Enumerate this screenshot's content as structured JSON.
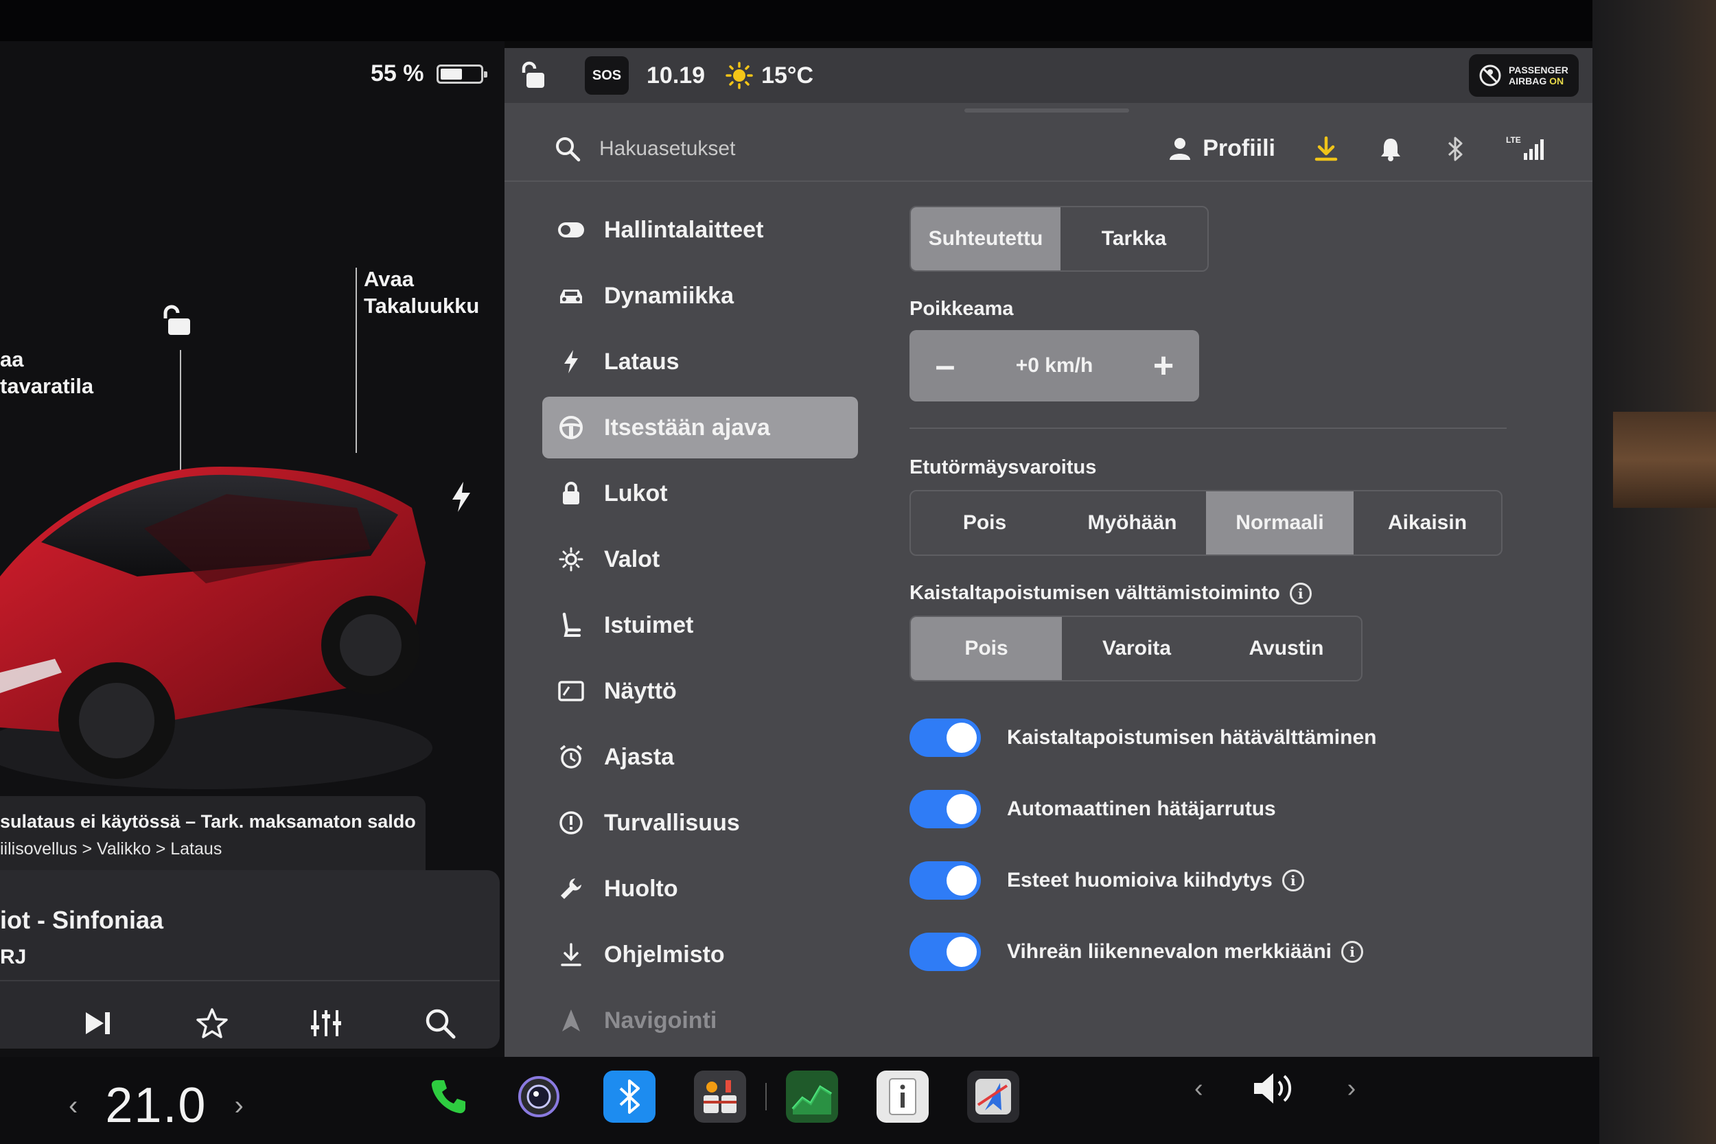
{
  "car_panel": {
    "battery_percent": "55 %",
    "battery_level": 0.55,
    "callout_frunk_line1": "aa",
    "callout_frunk_line2": "tavaratila",
    "callout_trunk_line1": "Avaa",
    "callout_trunk_line2": "Takaluukku",
    "car_color": "#b3121e",
    "notice_line1": "sulataus ei käytössä – Tark. maksamaton saldo",
    "notice_line2": "iilisovellus > Valikko > Lataus"
  },
  "media": {
    "track": "iot - Sinfoniaa",
    "station": "RJ"
  },
  "status_bar": {
    "sos_label": "SOS",
    "time": "10.19",
    "temperature": "15°C",
    "airbag_line1": "PASSENGER",
    "airbag_line2_prefix": "AIRBAG ",
    "airbag_line2_state": "ON"
  },
  "header": {
    "search_placeholder": "Hakuasetukset",
    "profile_label": "Profiili",
    "download_color": "#f0c419",
    "lte_label": "LTE"
  },
  "sidebar": {
    "items": [
      {
        "label": "Hallintalaitteet",
        "icon": "toggle-icon"
      },
      {
        "label": "Dynamiikka",
        "icon": "car-icon"
      },
      {
        "label": "Lataus",
        "icon": "bolt-icon"
      },
      {
        "label": "Itsestään ajava",
        "icon": "steering-wheel-icon",
        "active": true
      },
      {
        "label": "Lukot",
        "icon": "lock-icon"
      },
      {
        "label": "Valot",
        "icon": "light-icon"
      },
      {
        "label": "Istuimet",
        "icon": "seat-icon"
      },
      {
        "label": "Näyttö",
        "icon": "display-icon"
      },
      {
        "label": "Ajasta",
        "icon": "alarm-clock-icon"
      },
      {
        "label": "Turvallisuus",
        "icon": "alert-icon"
      },
      {
        "label": "Huolto",
        "icon": "wrench-icon"
      },
      {
        "label": "Ohjelmisto",
        "icon": "download-icon"
      },
      {
        "label": "Navigointi",
        "icon": "navigation-icon"
      }
    ]
  },
  "content": {
    "speed_mode": {
      "options": [
        "Suhteutettu",
        "Tarkka"
      ],
      "selected": "Suhteutettu"
    },
    "offset_label": "Poikkeama",
    "offset_value": "+0 km/h",
    "fcw_label": "Etutörmäysvaroitus",
    "fcw": {
      "options": [
        "Pois",
        "Myöhään",
        "Normaali",
        "Aikaisin"
      ],
      "selected": "Normaali"
    },
    "lane_label": "Kaistaltapoistumisen välttämistoiminto",
    "lane": {
      "options": [
        "Pois",
        "Varoita",
        "Avustin"
      ],
      "selected": "Pois"
    },
    "toggles": [
      {
        "label": "Kaistaltapoistumisen hätävälttäminen",
        "on": true,
        "info": false
      },
      {
        "label": "Automaattinen hätäjarrutus",
        "on": true,
        "info": false
      },
      {
        "label": "Esteet huomioiva kiihdytys",
        "on": true,
        "info": true
      },
      {
        "label": "Vihreän liikennevalon merkkiääni",
        "on": true,
        "info": true
      }
    ],
    "toggle_color": "#2f7cf6"
  },
  "taskbar": {
    "temperature_value": "21.0",
    "apps": [
      "phone-icon",
      "camera-icon",
      "bluetooth-icon",
      "toybox-icon",
      "energy-icon",
      "manual-icon",
      "navigation-app-icon"
    ]
  }
}
